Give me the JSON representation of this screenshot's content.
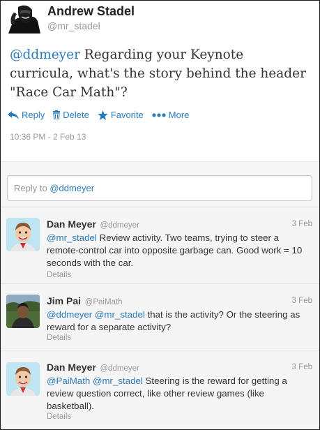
{
  "tweet": {
    "author_name": "Andrew Stadel",
    "author_handle": "@mr_stadel",
    "mention": "@ddmeyer",
    "text": " Regarding your Keynote curricula, what's the story behind the header \"Race Car Math\"?",
    "timestamp": "10:36 PM - 2 Feb 13",
    "actions": {
      "reply": "Reply",
      "delete": "Delete",
      "favorite": "Favorite",
      "more": "More"
    }
  },
  "reply_box": {
    "prefix": "Reply to ",
    "mention": "@ddmeyer"
  },
  "replies": [
    {
      "name": "Dan Meyer",
      "handle": "@ddmeyer",
      "date": "3 Feb",
      "mentions": "@mr_stadel",
      "text": " Review activity. Two teams, trying to steer a remote-control car into opposite garbage can. Good work = 10 seconds with the car.",
      "details": "Details"
    },
    {
      "name": "Jim Pai",
      "handle": "@PaiMath",
      "date": "3 Feb",
      "mentions": "@ddmeyer @mr_stadel",
      "text": " that is the activity?  Or the steering as reward for a separate activity?",
      "details": "Details"
    },
    {
      "name": "Dan Meyer",
      "handle": "@ddmeyer",
      "date": "3 Feb",
      "mentions": "@PaiMath @mr_stadel",
      "text": " Steering is the reward for getting a review question correct, like other review games (like basketball).",
      "details": "Details"
    }
  ],
  "colors": {
    "link": "#2a7bba",
    "muted": "#999999",
    "text": "#333333"
  }
}
